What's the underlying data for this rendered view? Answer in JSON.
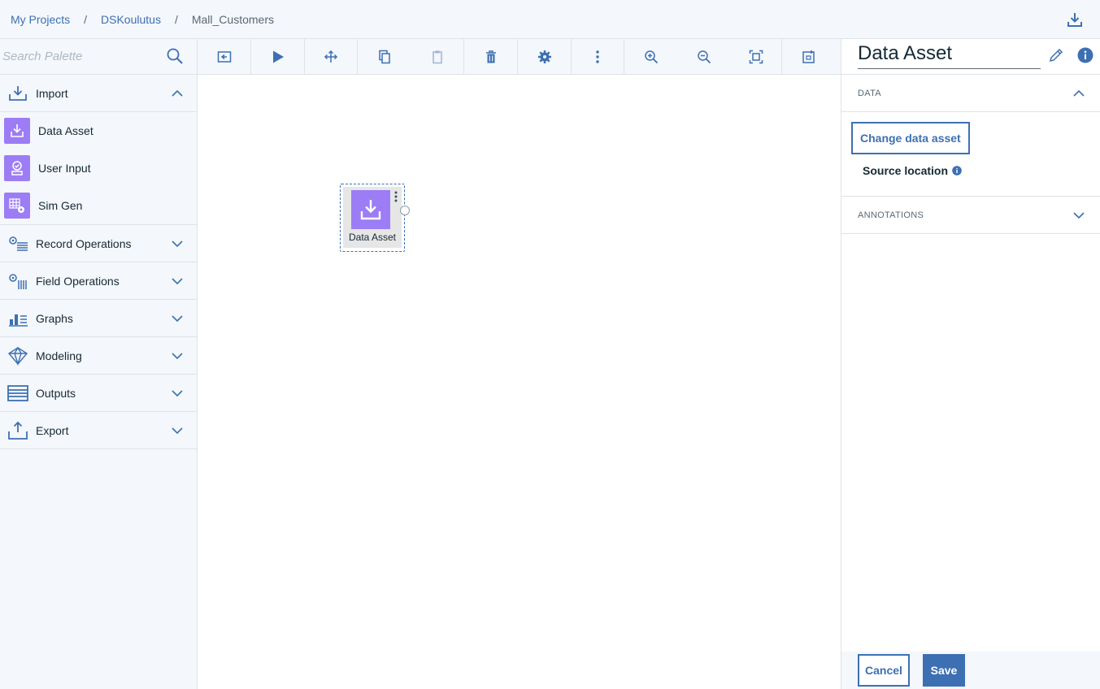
{
  "breadcrumb": {
    "items": [
      "My Projects",
      "DSKoulutus"
    ],
    "separator": "/",
    "current": "Mall_Customers"
  },
  "palette": {
    "search_placeholder": "Search Palette",
    "categories": [
      {
        "label": "Import",
        "icon": "import-icon",
        "expanded": true
      },
      {
        "label": "Record Operations",
        "icon": "record-operations-icon",
        "expanded": false
      },
      {
        "label": "Field Operations",
        "icon": "field-operations-icon",
        "expanded": false
      },
      {
        "label": "Graphs",
        "icon": "graphs-icon",
        "expanded": false
      },
      {
        "label": "Modeling",
        "icon": "modeling-icon",
        "expanded": false
      },
      {
        "label": "Outputs",
        "icon": "outputs-icon",
        "expanded": false
      },
      {
        "label": "Export",
        "icon": "export-icon",
        "expanded": false
      }
    ],
    "import_nodes": [
      {
        "label": "Data Asset",
        "icon": "data-asset-icon"
      },
      {
        "label": "User Input",
        "icon": "user-input-icon"
      },
      {
        "label": "Sim Gen",
        "icon": "sim-gen-icon"
      }
    ]
  },
  "toolbar": {
    "tools": [
      "toggle-palette-icon",
      "run-icon",
      "auto-arrange-icon",
      "copy-icon",
      "paste-icon",
      "delete-icon",
      "settings-icon",
      "more-icon",
      "zoom-in-icon",
      "zoom-out-icon",
      "fit-to-screen-icon",
      "comment-icon"
    ]
  },
  "canvas": {
    "node_label": "Data Asset"
  },
  "properties": {
    "title": "Data Asset",
    "data_section": "DATA",
    "change_button": "Change data asset",
    "source_location": "Source location",
    "annotations_section": "ANNOTATIONS",
    "cancel": "Cancel",
    "save": "Save"
  },
  "colors": {
    "accent": "#3d70b2",
    "node_purple": "#9c7df5",
    "panel_bg": "#f4f7fb"
  }
}
